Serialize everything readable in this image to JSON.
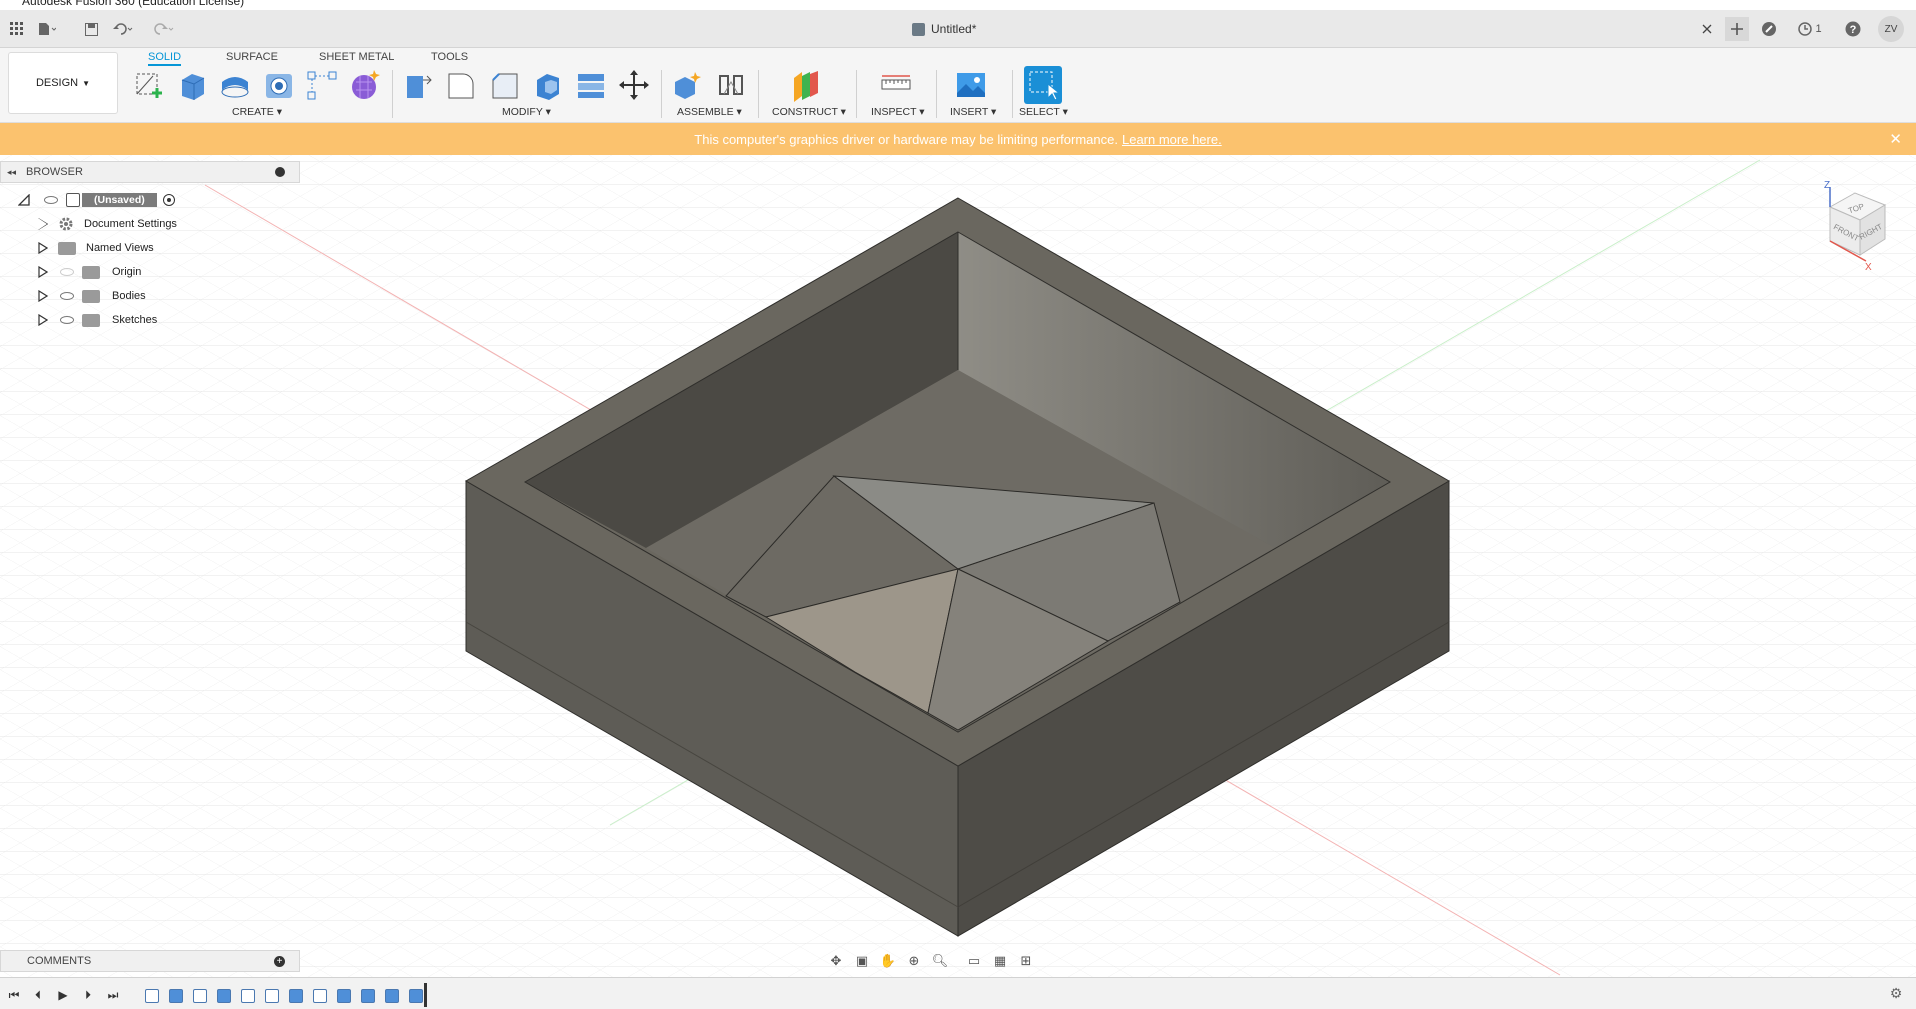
{
  "window": {
    "title": "Autodesk Fusion 360 (Education License)"
  },
  "app": {
    "document_tab": "Untitled*",
    "job_count": "1",
    "user_initials": "ZV"
  },
  "ribbon": {
    "workspace": "DESIGN",
    "tabs": [
      "SOLID",
      "SURFACE",
      "SHEET METAL",
      "TOOLS"
    ],
    "groups": {
      "create": "CREATE",
      "modify": "MODIFY",
      "assemble": "ASSEMBLE",
      "construct": "CONSTRUCT",
      "inspect": "INSPECT",
      "insert": "INSERT",
      "select": "SELECT"
    }
  },
  "banner": {
    "message": "This computer's graphics driver or hardware may be limiting performance.",
    "link": "Learn more here."
  },
  "browser": {
    "title": "BROWSER",
    "root": "(Unsaved)",
    "items": [
      {
        "label": "Document Settings",
        "icon": "gear-icon"
      },
      {
        "label": "Named Views",
        "icon": "folder-icon"
      },
      {
        "label": "Origin",
        "icon": "folder-icon"
      },
      {
        "label": "Bodies",
        "icon": "folder-icon"
      },
      {
        "label": "Sketches",
        "icon": "folder-icon"
      }
    ]
  },
  "comments": {
    "title": "COMMENTS"
  },
  "viewcube": {
    "top": "TOP",
    "front": "FRONT",
    "right": "RIGHT",
    "axis_z": "Z",
    "axis_x": "X"
  },
  "colors": {
    "accent": "#0696d7",
    "banner": "#fbc26e",
    "model_dark": "#5a5852",
    "model_mid": "#6e6b64",
    "grid": "#e4e4e4"
  }
}
